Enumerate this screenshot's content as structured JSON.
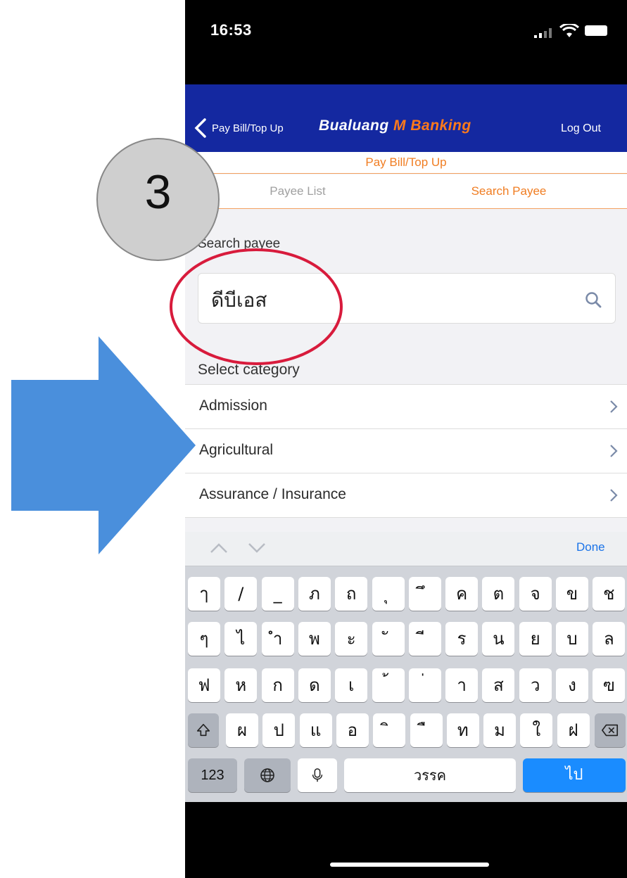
{
  "status_bar": {
    "time": "16:53"
  },
  "nav": {
    "back_label": "Pay Bill/Top Up",
    "brand_part1": "Bualuang ",
    "brand_part2": "M",
    "brand_part3": " Banking",
    "logout_label": "Log Out"
  },
  "page": {
    "subheader": "Pay Bill/Top Up",
    "tabs": [
      {
        "label": "Payee List",
        "active": false
      },
      {
        "label": "Search Payee",
        "active": true
      }
    ],
    "search_label": "Search payee",
    "search_value": "ดีบีเอส",
    "category_label": "Select category",
    "categories": [
      {
        "label": "Admission"
      },
      {
        "label": "Agricultural"
      },
      {
        "label": "Assurance / Insurance"
      }
    ]
  },
  "keyboard": {
    "done_label": "Done",
    "row1": [
      "ๅ",
      "/",
      "_",
      "ภ",
      "ถ",
      "ุ",
      "ึ",
      "ค",
      "ต",
      "จ",
      "ข",
      "ช"
    ],
    "row2": [
      "ๆ",
      "ไ",
      "ำ",
      "พ",
      "ะ",
      "ั",
      "ี",
      "ร",
      "น",
      "ย",
      "บ",
      "ล"
    ],
    "row3": [
      "ฟ",
      "ห",
      "ก",
      "ด",
      "เ",
      "้",
      "่",
      "า",
      "ส",
      "ว",
      "ง",
      "ฃ"
    ],
    "row4": [
      "ผ",
      "ป",
      "แ",
      "อ",
      "ิ",
      "ื",
      "ท",
      "ม",
      "ใ",
      "ฝ"
    ],
    "numbers_label": "123",
    "space_label": "วรรค",
    "go_label": "ไป"
  },
  "annotation": {
    "step_number": "3"
  },
  "colors": {
    "nav_blue": "#1428a0",
    "accent_orange": "#f07d22",
    "annotation_red": "#d81b3c",
    "arrow_blue": "#4a8fdc",
    "key_blue": "#1a8cff"
  }
}
